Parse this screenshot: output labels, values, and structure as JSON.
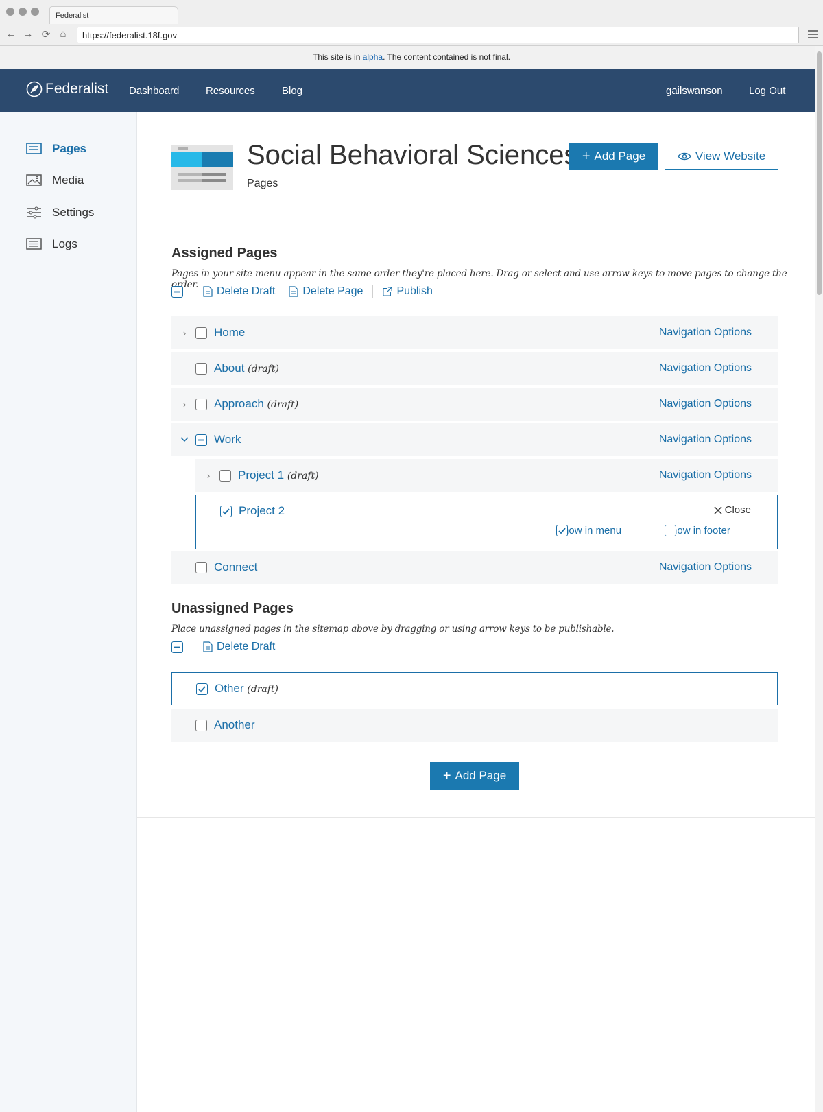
{
  "browser": {
    "tab_title": "Federalist",
    "url": "https://federalist.18f.gov"
  },
  "banner": {
    "prefix": "This site is in ",
    "link": "alpha",
    "suffix": ". The content contained is not final."
  },
  "header": {
    "logo": "Federalist",
    "nav": [
      "Dashboard",
      "Resources",
      "Blog"
    ],
    "user": "gailswanson",
    "logout": "Log Out"
  },
  "sidebar": {
    "items": [
      {
        "label": "Pages",
        "icon": "pages-icon",
        "active": true
      },
      {
        "label": "Media",
        "icon": "image-icon"
      },
      {
        "label": "Settings",
        "icon": "sliders-icon"
      },
      {
        "label": "Logs",
        "icon": "list-icon"
      }
    ]
  },
  "site": {
    "title": "Social Behavioral Sciences",
    "subtitle": "Pages",
    "add_page": "Add Page",
    "view_website": "View Website"
  },
  "assigned": {
    "heading": "Assigned Pages",
    "description": "Pages in your site menu appear in the same order they're placed here. Drag or select and use arrow keys to move pages to change the order.",
    "toolbar": {
      "delete_draft": "Delete Draft",
      "delete_page": "Delete Page",
      "publish": "Publish"
    },
    "nav_options": "Navigation Options",
    "draft_label": "(draft)",
    "rows": [
      {
        "label": "Home"
      },
      {
        "label": "About"
      },
      {
        "label": "Approach"
      },
      {
        "label": "Work"
      },
      {
        "label": "Project 1"
      },
      {
        "label": "Project 2"
      },
      {
        "label": "Connect"
      }
    ],
    "close": "Close",
    "show_in_menu": "Show in menu",
    "show_in_footer": "Show in footer"
  },
  "unassigned": {
    "heading": "Unassigned Pages",
    "description": "Place unassigned pages in the sitemap above by dragging or using arrow keys to be publishable.",
    "toolbar": {
      "delete_draft": "Delete Draft"
    },
    "rows": [
      {
        "label": "Other"
      },
      {
        "label": "Another"
      }
    ],
    "add_page": "Add Page"
  },
  "colors": {
    "header": "#2c4a6e",
    "accent": "#1b79b0",
    "link": "#1b6fa8"
  }
}
